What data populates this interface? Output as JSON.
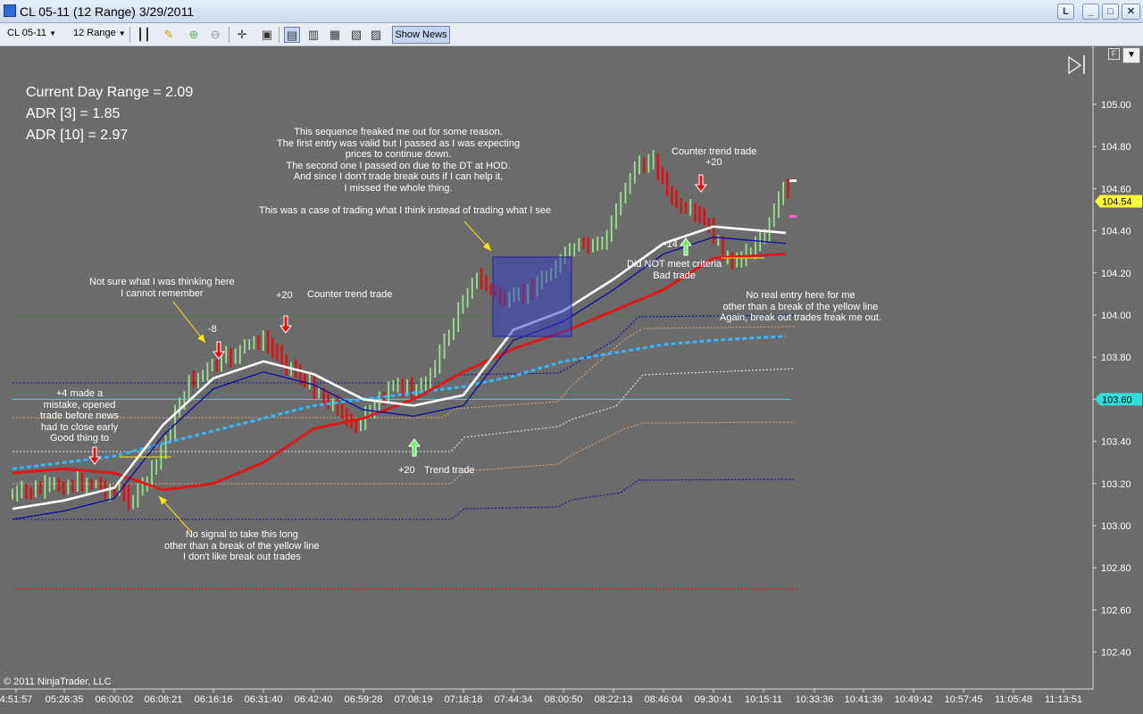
{
  "window": {
    "title": "CL 05-11 (12 Range)  3/29/2011",
    "buttons": [
      "L",
      "_",
      "□",
      "✕"
    ]
  },
  "toolbar": {
    "instrument": "CL 05-11",
    "interval": "12 Range",
    "show_news_label": "Show News",
    "icons": [
      "bar-style-icon",
      "draw-pencil-icon",
      "zoom-in-icon",
      "zoom-out-icon",
      "crosshair-icon",
      "zoom-box-icon",
      "chart-trader-icon",
      "indicators-icon",
      "strategies-icon",
      "properties-icon",
      "data-box-icon"
    ]
  },
  "chart": {
    "f_button": "F",
    "collapse_button": "▼",
    "stats": [
      "Current Day Range = 2.09",
      "ADR [3] = 1.85",
      "ADR [10] = 2.97"
    ],
    "copyright": "© 2011 NinjaTrader, LLC",
    "price_labels": [
      "105.00",
      "104.80",
      "104.60",
      "104.40",
      "104.20",
      "104.00",
      "103.80",
      "103.60",
      "103.40",
      "103.20",
      "103.00",
      "102.80",
      "102.60",
      "102.40"
    ],
    "time_labels": [
      "4:51:57",
      "05:26:35",
      "06:00:02",
      "06:08:21",
      "06:16:16",
      "06:31:40",
      "06:42:40",
      "06:59:28",
      "07:08:19",
      "07:18:18",
      "07:44:34",
      "08:00:50",
      "08:22:13",
      "08:46:04",
      "09:30:41",
      "10:15:11",
      "10:33:36",
      "10:41:39",
      "10:49:42",
      "10:57:45",
      "11:05:48",
      "11:13:51"
    ],
    "price_markers": {
      "last_price": "104.54",
      "last_price_color": "#ffff33",
      "level": "103.60",
      "level_color": "#33dddd"
    },
    "annotations": {
      "not_sure": [
        "Not sure what I was thinking here",
        "I cannot remember"
      ],
      "minus_eight": "-8",
      "plus_four": [
        "+4 made a",
        "mistake, opened",
        "trade before news",
        "had to close early",
        "Good thing to"
      ],
      "no_signal": [
        "No signal to take this long",
        "other than a break of the yellow line",
        "I don't like break out trades"
      ],
      "plus_twenty_ct": "+20",
      "counter_trend_1": "Counter trend trade",
      "freaked": [
        "This sequence freaked me out for some reason.",
        "The first entry was valid but I passed as I was expecting",
        "prices to continue down.",
        "The second one I passed on due to the DT at HOD.",
        "And since I don't trade break outs if I can help it,",
        "I missed the whole thing."
      ],
      "case_of": "This was a case of trading what I think instead of trading what I see",
      "plus_twenty_trend": "+20",
      "trend_trade": "Trend trade",
      "counter_trend_2": "Counter trend trade",
      "plus_twenty_top": "+20",
      "minus_fourteen": "-14",
      "did_not_meet": [
        "Did NOT meet criteria",
        "Bad trade"
      ],
      "no_real_entry": [
        "No real entry here for me",
        "other than a break of the yellow line",
        "Again, break out trades freak me out."
      ]
    },
    "colors": {
      "background": "#6b6b6b",
      "up_bar": "#9be58c",
      "down_bar": "#e01010",
      "fast_ma": "#ffffff",
      "slow_ma": "#e01818",
      "vwap": "#33b5ff",
      "band": "#0a0aa0",
      "pivot_red": "#dd1111",
      "pivot_tan": "#d8a47a",
      "long_arrow": "#6cf06c",
      "short_arrow": "#e01010",
      "callout": "#ffe800"
    }
  },
  "chart_data": {
    "type": "line",
    "xlabel": "",
    "ylabel": "",
    "ylim": [
      102.3,
      105.15
    ],
    "x": [
      "4:51:57",
      "05:26:35",
      "06:00:02",
      "06:08:21",
      "06:16:16",
      "06:31:40",
      "06:42:40",
      "06:59:28",
      "07:08:19",
      "07:18:18",
      "07:44:34",
      "08:00:50",
      "08:22:13",
      "08:46:04",
      "09:30:41",
      "10:15:11"
    ],
    "series": [
      {
        "values": [
          103.08,
          103.12,
          103.18,
          103.48,
          103.7,
          103.78,
          103.72,
          103.6,
          103.57,
          103.62,
          103.93,
          104.02,
          104.17,
          104.34,
          104.42,
          104.39
        ]
      },
      {
        "values": [
          103.25,
          103.27,
          103.25,
          103.17,
          103.2,
          103.3,
          103.46,
          103.51,
          103.6,
          103.73,
          103.84,
          103.92,
          104.02,
          104.12,
          104.27,
          104.29
        ]
      },
      {
        "values": [
          103.27,
          103.3,
          103.33,
          103.39,
          103.45,
          103.51,
          103.57,
          103.6,
          103.63,
          103.66,
          103.71,
          103.78,
          103.82,
          103.86,
          103.88,
          103.9
        ]
      }
    ],
    "levels": [
      102.7,
      103.0,
      103.22,
      103.5,
      103.6,
      103.67,
      103.75
    ]
  }
}
